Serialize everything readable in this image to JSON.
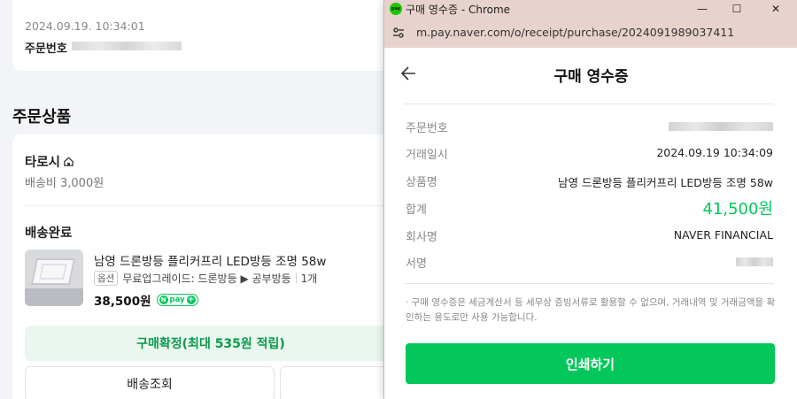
{
  "background_page": {
    "order_date": "2024.09.19. 10:34:01",
    "order_number_label": "주문번호",
    "section_title": "주문상품",
    "store_name": "타로시",
    "shipping_fee": "배송비 3,000원",
    "shipping_status": "배송완료",
    "product_name": "남영 드론방등 플리커프리 LED방등 조명 58w",
    "option_tag": "옵션",
    "option_text": "무료업그레이드: 드론방등 ▶ 공부방등",
    "quantity": "1개",
    "price": "38,500원",
    "npay_badge": "pay",
    "confirm_button": "구매확정(최대 535원 적립)",
    "track_button": "배송조회"
  },
  "popup": {
    "window_title": "구매 영수증 - Chrome",
    "favicon_text": "pay",
    "controls": {
      "minimize": "—",
      "maximize": "☐",
      "close": "✕"
    },
    "url": "m.pay.naver.com/o/receipt/purchase/2024091989037411",
    "title": "구매 영수증",
    "rows": {
      "order_number_label": "주문번호",
      "datetime_label": "거래일시",
      "datetime_value": "2024.09.19 10:34:09",
      "product_label": "상품명",
      "product_value": "남영 드론방등 플리커프리 LED방등 조명 58w",
      "total_label": "합계",
      "total_value": "41,500원",
      "company_label": "회사명",
      "company_value": "NAVER FINANCIAL",
      "signature_label": "서명"
    },
    "notice": "· 구매 영수증은 세금계산서 등 세무상 증빙서류로 활용할 수 없으며, 거래내역 및 거래금액을 확인하는 용도로만 사용 가능합니다.",
    "print_button": "인쇄하기"
  },
  "colors": {
    "naver_green": "#03c75a",
    "titlebar": "#e7d2cd",
    "confirm_bg": "#e9f7ee"
  }
}
